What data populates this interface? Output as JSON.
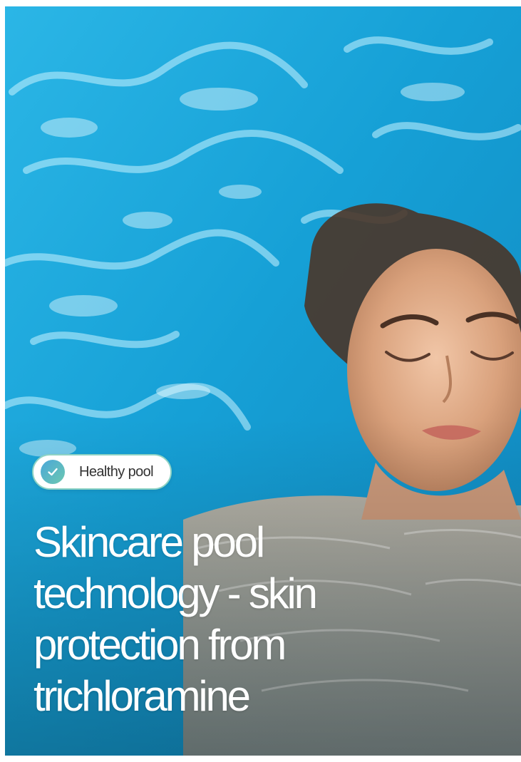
{
  "card": {
    "badge": {
      "icon": "check-circle-icon",
      "label": "Healthy pool"
    },
    "headline": "Skincare pool technology - skin protection from trichloramine",
    "image": {
      "description_icon": "swimmer-photo"
    }
  },
  "colors": {
    "water": "#1fa8d8",
    "badge_border": "#8fd3c4",
    "badge_icon_gradient_start": "#4aa7d9",
    "badge_icon_gradient_end": "#6cc8b0",
    "headline_text": "#ffffff"
  }
}
